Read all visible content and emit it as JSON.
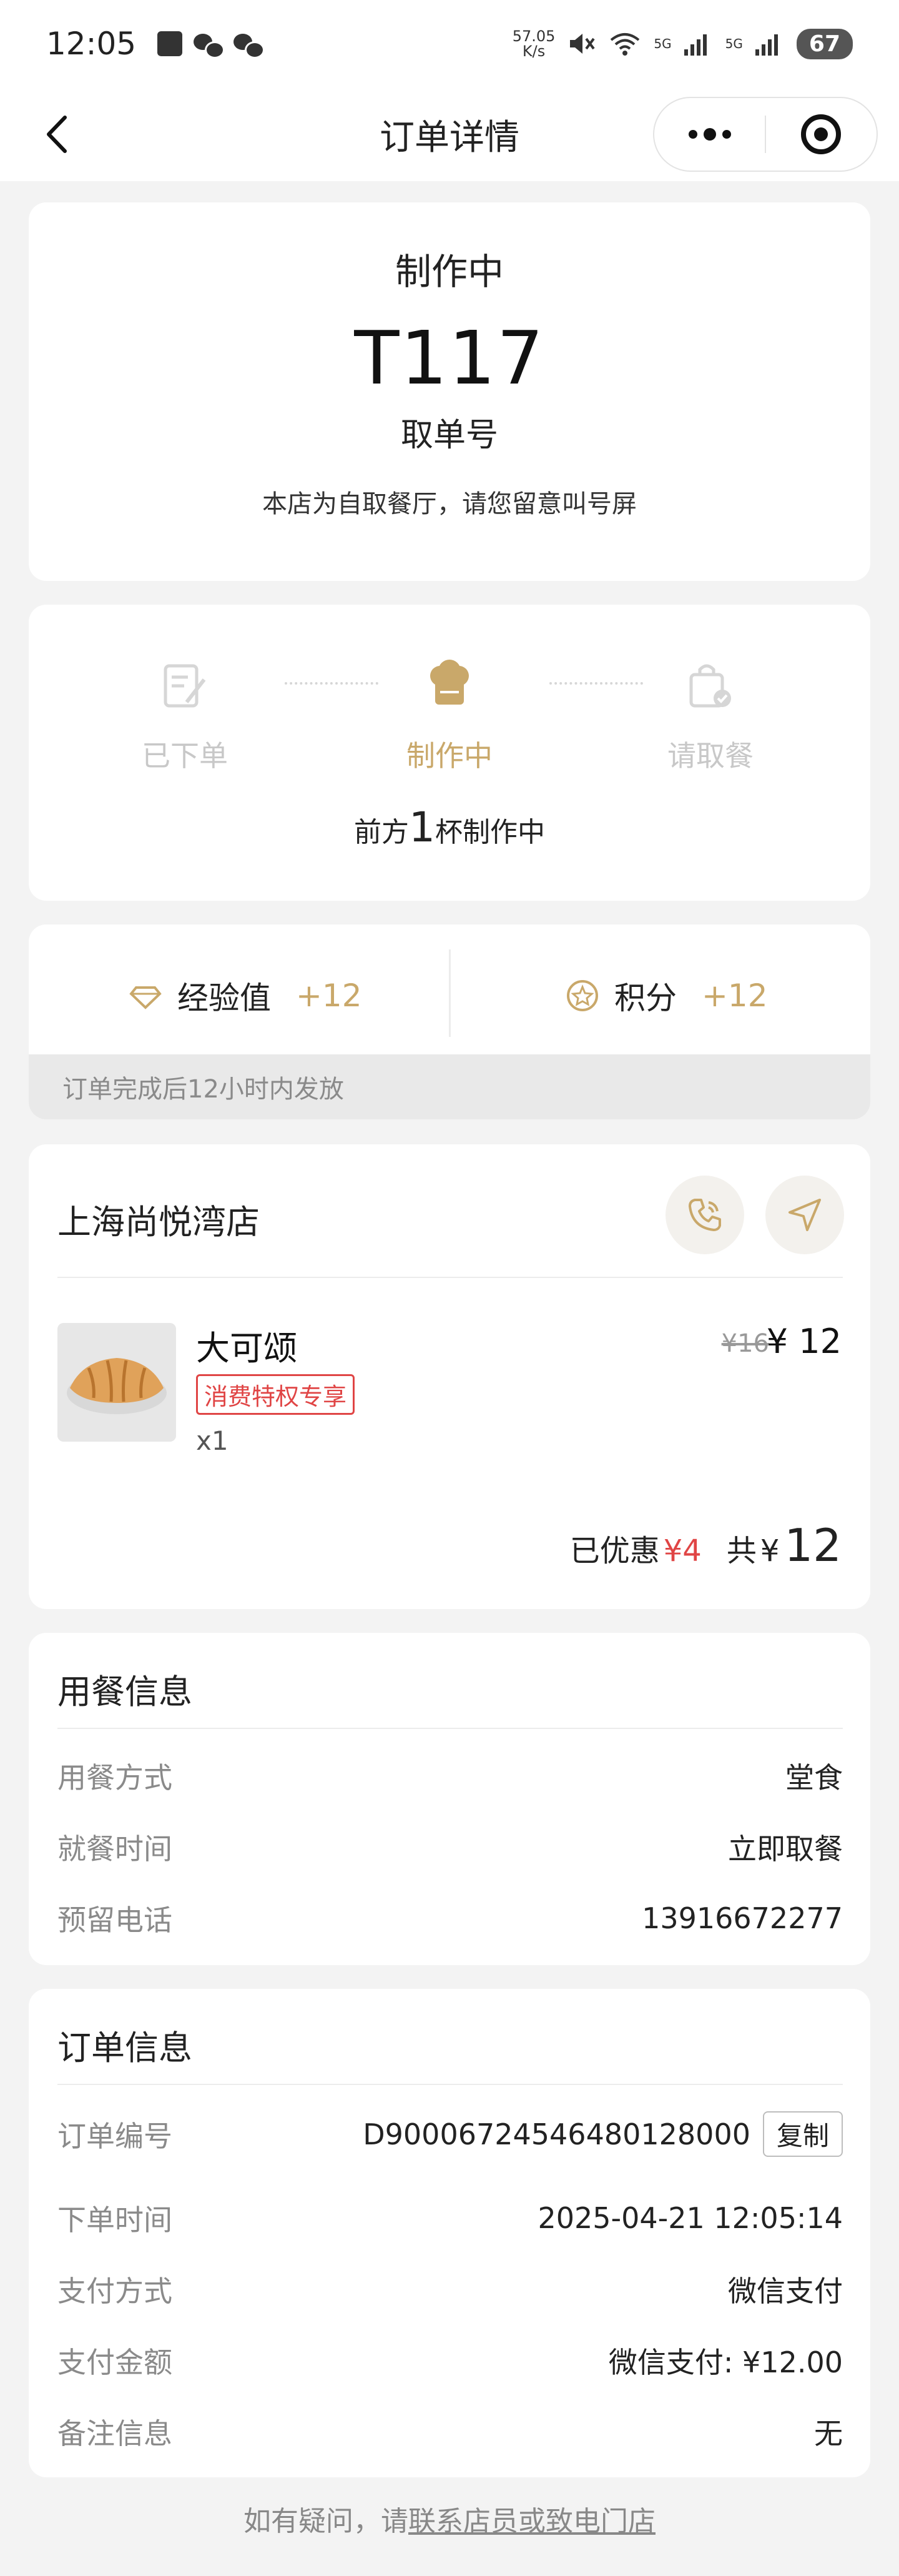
{
  "status_bar": {
    "time": "12:05",
    "speed_top": "57.05",
    "speed_bottom": "K/s",
    "network_1": "5G",
    "network_2": "5G",
    "battery": "67"
  },
  "nav": {
    "title": "订单详情"
  },
  "order_status": {
    "status": "制作中",
    "pickup_number": "T117",
    "pickup_label": "取单号",
    "note": "本店为自取餐厅，请您留意叫号屏"
  },
  "progress": {
    "steps": [
      {
        "label": "已下单",
        "icon": "order-placed-icon"
      },
      {
        "label": "制作中",
        "icon": "chef-hat-icon"
      },
      {
        "label": "请取餐",
        "icon": "pickup-bag-icon"
      }
    ],
    "queue_prefix": "前方",
    "queue_count": "1",
    "queue_suffix": "杯制作中",
    "active_color": "#c9a86a"
  },
  "rewards": {
    "exp_label": "经验值",
    "exp_value": "+12",
    "points_label": "积分",
    "points_value": "+12",
    "footer": "订单完成后12小时内发放"
  },
  "store": {
    "name": "上海尚悦湾店",
    "item_name": "大可颂",
    "item_tag": "消费特权专享",
    "item_qty": "x1",
    "original_price": "¥16",
    "price": "¥ 12",
    "discount_label": "已优惠",
    "discount_value": "¥4",
    "total_label": "共",
    "total_yen": "¥",
    "total_value": "12"
  },
  "dining": {
    "title": "用餐信息",
    "rows": [
      {
        "key": "用餐方式",
        "value": "堂食"
      },
      {
        "key": "就餐时间",
        "value": "立即取餐"
      },
      {
        "key": "预留电话",
        "value": "13916672277"
      }
    ]
  },
  "order_info": {
    "title": "订单信息",
    "rows": [
      {
        "key": "订单编号",
        "value": "D90006724546480128000"
      },
      {
        "key": "下单时间",
        "value": "2025-04-21 12:05:14"
      },
      {
        "key": "支付方式",
        "value": "微信支付"
      },
      {
        "key": "支付金额",
        "value": "微信支付: ¥12.00"
      },
      {
        "key": "备注信息",
        "value": "无"
      }
    ],
    "copy_label": "复制"
  },
  "help": {
    "prefix": "如有疑问，请",
    "link": "联系店员或致电门店"
  }
}
